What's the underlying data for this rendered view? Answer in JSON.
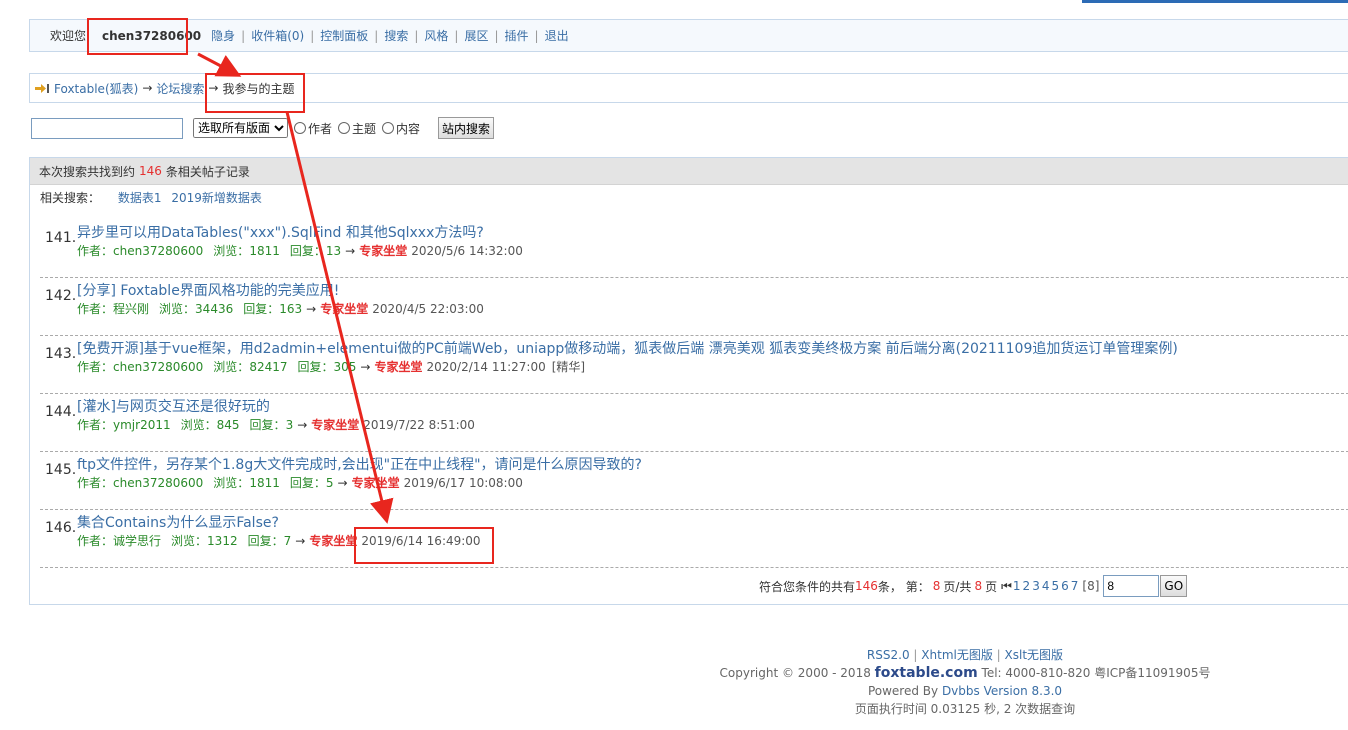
{
  "userbar": {
    "welcome": "欢迎您",
    "username": "chen37280600",
    "links": [
      "隐身",
      "收件箱(0)",
      "控制面板",
      "搜索",
      "风格",
      "展区",
      "插件",
      "退出"
    ]
  },
  "breadcrumb": {
    "home": "Foxtable(狐表)",
    "arrow": "→",
    "search": "论坛搜索",
    "current": "我参与的主题"
  },
  "search": {
    "keyword": "",
    "board_select": "选取所有版面",
    "options": [
      "作者",
      "主题",
      "内容"
    ],
    "button": "站内搜索"
  },
  "results": {
    "summary_pre": "本次搜索共找到约",
    "count": "146",
    "summary_post": "条相关帖子记录",
    "related_label": "相关搜索：",
    "related": [
      "数据表1",
      "2019新增数据表"
    ],
    "items": [
      {
        "num": "141.",
        "title": "异步里可以用DataTables(\"xxx\").SqlFind 和其他Sqlxxx方法吗?",
        "author": "chen37280600",
        "views": "1811",
        "replies": "13",
        "forum": "专家坐堂",
        "date": "2020/5/6 14:32:00",
        "tag": ""
      },
      {
        "num": "142.",
        "title": "[分享] Foxtable界面风格功能的完美应用!",
        "author": "程兴刚",
        "views": "34436",
        "replies": "163",
        "forum": "专家坐堂",
        "date": "2020/4/5 22:03:00",
        "tag": ""
      },
      {
        "num": "143.",
        "title": "[免费开源]基于vue框架，用d2admin+elementui做的PC前端Web，uniapp做移动端，狐表做后端 漂亮美观 狐表变美终极方案 前后端分离(20211109追加货运订单管理案例)",
        "author": "chen37280600",
        "views": "82417",
        "replies": "305",
        "forum": "专家坐堂",
        "date": "2020/2/14 11:27:00",
        "tag": "[精华]"
      },
      {
        "num": "144.",
        "title": "[灌水]与网页交互还是很好玩的",
        "author": "ymjr2011",
        "views": "845",
        "replies": "3",
        "forum": "专家坐堂",
        "date": "2019/7/22 8:51:00",
        "tag": ""
      },
      {
        "num": "145.",
        "title": "ftp文件控件，另存某个1.8g大文件完成时,会出现\"正在中止线程\"，请问是什么原因导致的?",
        "author": "chen37280600",
        "views": "1811",
        "replies": "5",
        "forum": "专家坐堂",
        "date": "2019/6/17 10:08:00",
        "tag": ""
      },
      {
        "num": "146.",
        "title": "集合Contains为什么显示False?",
        "author": "诚学思行",
        "views": "1312",
        "replies": "7",
        "forum": "专家坐堂",
        "date": "2019/6/14 16:49:00",
        "tag": ""
      }
    ],
    "labels": {
      "author": "作者：",
      "views": "浏览：",
      "replies": "回复：",
      "arrow": "→"
    }
  },
  "pager": {
    "pre": "符合您条件的共有",
    "total": "146",
    "mid1": "条，  第：",
    "page": "8",
    "mid2": "页/共",
    "pages": "8",
    "mid3": "页",
    "first_icon": "⏮",
    "numbers": [
      "1",
      "2",
      "3",
      "4",
      "5",
      "6",
      "7"
    ],
    "current": "[8]",
    "input": "8",
    "go": "GO"
  },
  "footer": {
    "links": [
      "RSS2.0",
      "Xhtml无图版",
      "Xslt无图版"
    ],
    "copyright": "Copyright © 2000 - 2018",
    "brand": "foxtable.com",
    "contact": "Tel: 4000-810-820 粤ICP备11091905号",
    "powered": "Powered By",
    "version": "Dvbbs Version 8.3.0",
    "exec": "页面执行时间 0.03125 秒, 2 次数据查询"
  },
  "colors": {
    "annotation": "#e8261e",
    "link": "#3a6ea5",
    "meta_green": "#2a8a2a",
    "highlight_red": "#e53030"
  }
}
